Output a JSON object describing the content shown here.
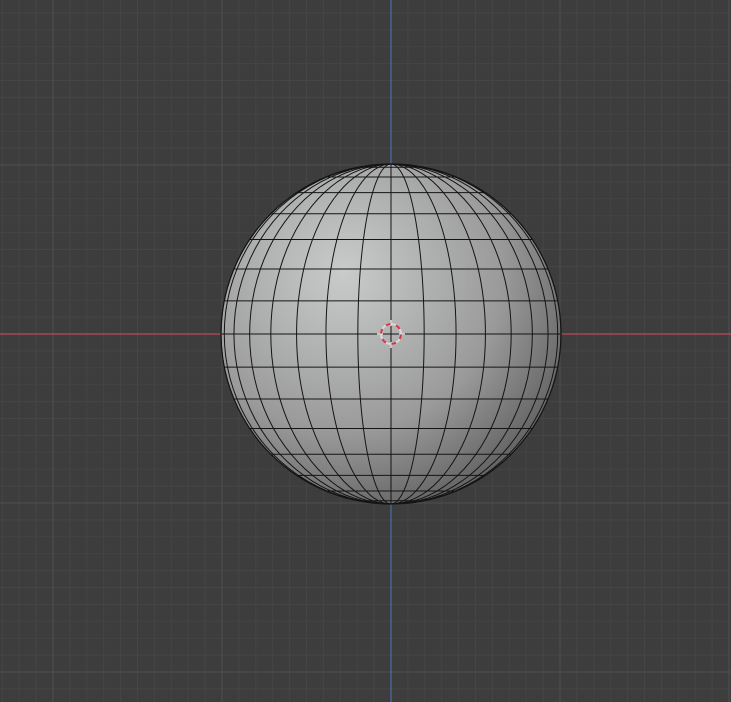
{
  "viewport": {
    "background": "#3d3d3d",
    "grid_minor_color": "#454545",
    "grid_major_color": "#4f4f4f",
    "x_axis_color": "#c04855",
    "z_axis_color": "#4a6fa8"
  },
  "mesh": {
    "object_type": "uv-sphere",
    "segments": 32,
    "rings": 16,
    "wire_color": "#141414",
    "shade_light": "#c9cbcb",
    "shade_mid": "#9a9a9a",
    "shade_dark": "#4a4a4a"
  },
  "origin_marker": {
    "icon": "3d-cursor-icon",
    "color_a": "#d9d9d9",
    "color_b": "#d6354a"
  }
}
